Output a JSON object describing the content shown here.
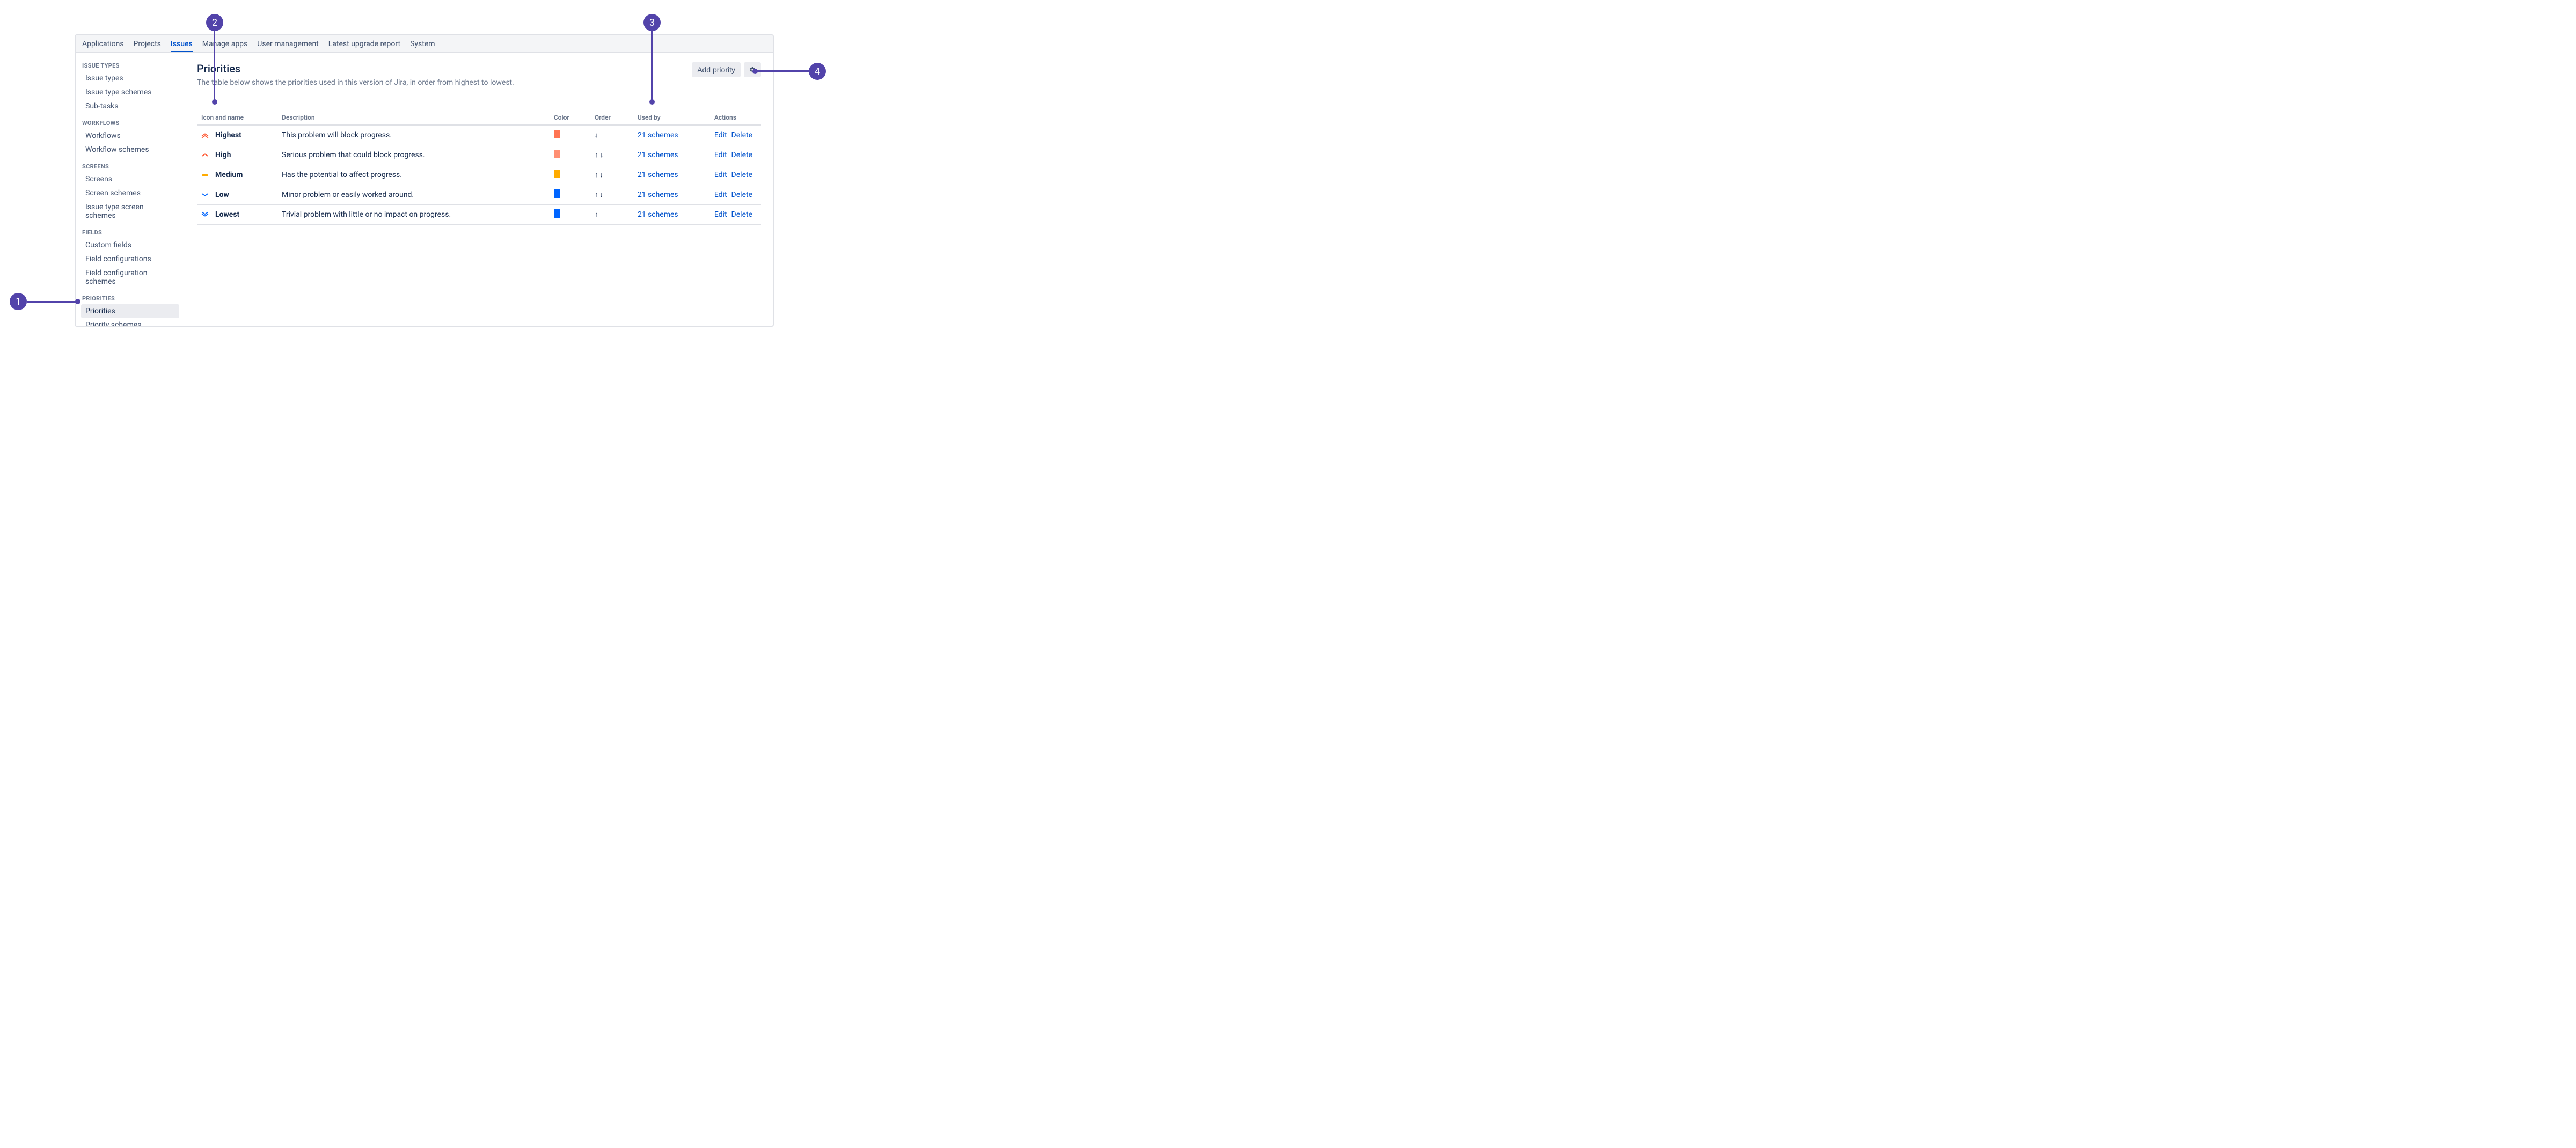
{
  "topnav": {
    "items": [
      "Applications",
      "Projects",
      "Issues",
      "Manage apps",
      "User management",
      "Latest upgrade report",
      "System"
    ],
    "activeIndex": 2
  },
  "sidebar": {
    "groups": [
      {
        "title": "ISSUE TYPES",
        "items": [
          "Issue types",
          "Issue type schemes",
          "Sub-tasks"
        ]
      },
      {
        "title": "WORKFLOWS",
        "items": [
          "Workflows",
          "Workflow schemes"
        ]
      },
      {
        "title": "SCREENS",
        "items": [
          "Screens",
          "Screen schemes",
          "Issue type screen schemes"
        ]
      },
      {
        "title": "FIELDS",
        "items": [
          "Custom fields",
          "Field configurations",
          "Field configuration schemes"
        ]
      },
      {
        "title": "PRIORITIES",
        "items": [
          "Priorities",
          "Priority schemes"
        ]
      }
    ],
    "selected": "Priorities"
  },
  "page": {
    "title": "Priorities",
    "subtitle": "The table below shows the priorities used in this version of Jira, in order from highest to lowest.",
    "addButton": "Add priority"
  },
  "table": {
    "headers": {
      "icon": "Icon and name",
      "desc": "Description",
      "color": "Color",
      "order": "Order",
      "used": "Used by",
      "actions": "Actions"
    },
    "rows": [
      {
        "icon": "highest",
        "name": "Highest",
        "desc": "This problem will block progress.",
        "color": "#FF7452",
        "order": "down",
        "used": "21 schemes",
        "edit": "Edit",
        "delete": "Delete"
      },
      {
        "icon": "high",
        "name": "High",
        "desc": "Serious problem that could block progress.",
        "color": "#FF8F73",
        "order": "updown",
        "used": "21 schemes",
        "edit": "Edit",
        "delete": "Delete"
      },
      {
        "icon": "medium",
        "name": "Medium",
        "desc": "Has the potential to affect progress.",
        "color": "#FFAB00",
        "order": "updown",
        "used": "21 schemes",
        "edit": "Edit",
        "delete": "Delete"
      },
      {
        "icon": "low",
        "name": "Low",
        "desc": "Minor problem or easily worked around.",
        "color": "#0065FF",
        "order": "updown",
        "used": "21 schemes",
        "edit": "Edit",
        "delete": "Delete"
      },
      {
        "icon": "lowest",
        "name": "Lowest",
        "desc": "Trivial problem with little or no impact on progress.",
        "color": "#0065FF",
        "order": "up",
        "used": "21 schemes",
        "edit": "Edit",
        "delete": "Delete"
      }
    ]
  },
  "callouts": [
    "1",
    "2",
    "3",
    "4"
  ]
}
